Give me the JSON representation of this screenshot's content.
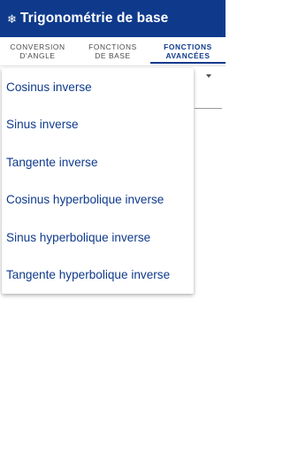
{
  "app": {
    "icon": "snowflake-icon",
    "title": "Trigonométrie de base",
    "colors": {
      "primary": "#0f3a8c",
      "tab_inactive": "#4a4a4a"
    }
  },
  "tabs": [
    {
      "label": "CONVERSION\nD'ANGLE",
      "selected": false
    },
    {
      "label": "FONCTIONS\nDE BASE",
      "selected": false
    },
    {
      "label": "FONCTIONS\nAVANCÉES",
      "selected": true
    }
  ],
  "dropdown": {
    "options": [
      "Cosinus inverse",
      "Sinus inverse",
      "Tangente inverse",
      "Cosinus hyperbolique inverse",
      "Sinus hyperbolique inverse",
      "Tangente hyperbolique inverse"
    ]
  }
}
